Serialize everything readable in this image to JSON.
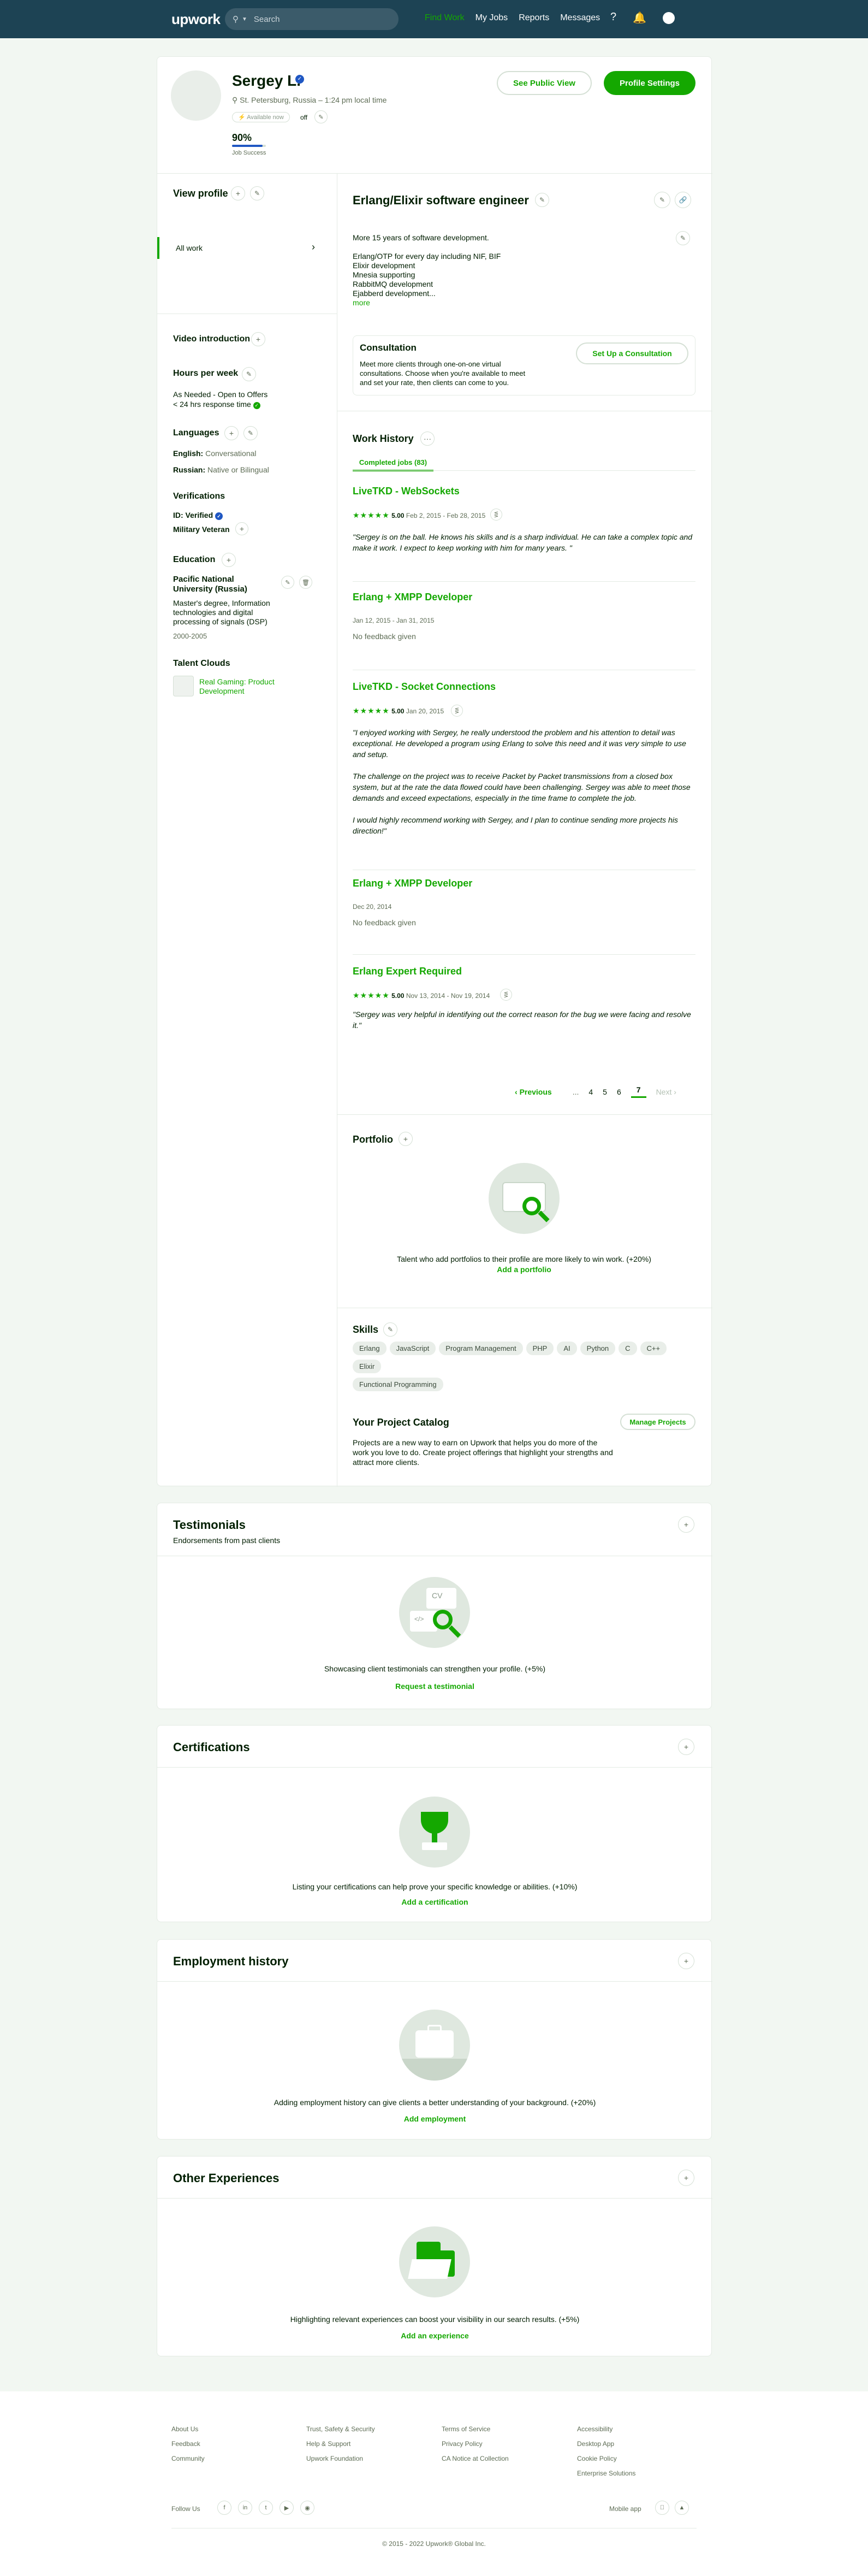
{
  "nav": {
    "logo": "upwork",
    "search_placeholder": "Search",
    "links": [
      "Find Work",
      "My Jobs",
      "Reports",
      "Messages"
    ]
  },
  "profile": {
    "name": "Sergey L.",
    "location": "St. Petersburg, Russia – 1:24 pm local time",
    "availability": "Available now",
    "availability_toggle": "off",
    "job_success": "90%",
    "job_success_label": "Job Success",
    "public_view": "See Public View",
    "settings": "Profile Settings"
  },
  "sidebar": {
    "view_profile": "View profile",
    "all_work": "All work",
    "video_intro": "Video introduction",
    "hours_title": "Hours per week",
    "hours_value": "As Needed - Open to Offers",
    "response_time": "< 24 hrs response time",
    "languages_title": "Languages",
    "languages": [
      {
        "name": "English:",
        "level": "Conversational"
      },
      {
        "name": "Russian:",
        "level": "Native or Bilingual"
      }
    ],
    "verifications_title": "Verifications",
    "id_verified": "ID: Verified",
    "military": "Military Veteran",
    "education_title": "Education",
    "school": "Pacific National University (Russia)",
    "degree": "Master's degree, Information technologies and digital processing of signals (DSP)",
    "years": "2000-2005",
    "clouds_title": "Talent Clouds",
    "cloud_name": "Real Gaming: Product Development"
  },
  "main": {
    "title": "Erlang/Elixir software engineer",
    "overview": [
      "More 15 years of software development.",
      "",
      "Erlang/OTP for every day including NIF, BIF",
      "Elixir development",
      "Mnesia supporting",
      "RabbitMQ development",
      "Ejabberd development..."
    ],
    "more": "more",
    "consult_title": "Consultation",
    "consult_text": "Meet more clients through one-on-one virtual consultations. Choose when you're available to meet and set your rate, then clients can come to you.",
    "consult_btn": "Set Up a Consultation",
    "work_history": "Work History",
    "tab_completed": "Completed jobs (83)"
  },
  "jobs": [
    {
      "title": "LiveTKD - WebSockets",
      "rating": "5.00",
      "dates": "Feb 2, 2015 - Feb 28, 2015",
      "feedback": "\"Sergey is on the ball. He knows his skills and is a sharp individual. He can take a complex topic and make it work. I expect to keep working with him for many years. \""
    },
    {
      "title": "Erlang + XMPP Developer",
      "dates": "Jan 12, 2015 - Jan 31, 2015",
      "nofeedback": "No feedback given"
    },
    {
      "title": "LiveTKD - Socket Connections",
      "rating": "5.00",
      "dates": "Jan 20, 2015",
      "feedback": "\"I enjoyed working with Sergey, he really understood the problem and his attention to detail was exceptional. He developed a program using Erlang to solve this need and it was very simple to use and setup.",
      "feedback2": "The challenge on the project was to receive Packet by Packet transmissions from a closed box system, but at the rate the data flowed could have been challenging. Sergey was able to meet those demands and exceed expectations, especially in the time frame to complete the job.",
      "feedback3": "I would highly recommend working with Sergey, and I plan to continue sending more projects his direction!\""
    },
    {
      "title": "Erlang + XMPP Developer",
      "dates": "Dec 20, 2014",
      "nofeedback": "No feedback given"
    },
    {
      "title": "Erlang Expert Required",
      "rating": "5.00",
      "dates": "Nov 13, 2014 - Nov 19, 2014",
      "feedback": "\"Sergey was very helpful in identifying out the correct reason for the bug we were facing and resolve it.\""
    }
  ],
  "pagination": {
    "prev": "Previous",
    "ellipsis": "...",
    "pages": [
      "4",
      "5",
      "6",
      "7"
    ],
    "current": "7",
    "next": "Next"
  },
  "portfolio": {
    "title": "Portfolio",
    "text": "Talent who add portfolios to their profile are more likely to win work. (+20%)",
    "link": "Add a portfolio"
  },
  "skills": {
    "title": "Skills",
    "items": [
      "Erlang",
      "JavaScript",
      "Program Management",
      "PHP",
      "AI",
      "Python",
      "C",
      "C++",
      "Elixir",
      "Functional Programming"
    ]
  },
  "catalog": {
    "title": "Your Project Catalog",
    "text": "Projects are a new way to earn on Upwork that helps you do more of the work you love to do. Create project offerings that highlight your strengths and attract more clients.",
    "btn": "Manage Projects"
  },
  "testimonials": {
    "title": "Testimonials",
    "sub": "Endorsements from past clients",
    "text": "Showcasing client testimonials can strengthen your profile. (+5%)",
    "link": "Request a testimonial",
    "cv": "CV"
  },
  "certifications": {
    "title": "Certifications",
    "text": "Listing your certifications can help prove your specific knowledge or abilities. (+10%)",
    "link": "Add a certification"
  },
  "employment": {
    "title": "Employment history",
    "text": "Adding employment history can give clients a better understanding of your background. (+20%)",
    "link": "Add employment"
  },
  "other": {
    "title": "Other Experiences",
    "text": "Highlighting relevant experiences can boost your visibility in our search results. (+5%)",
    "link": "Add an experience"
  },
  "footer": {
    "cols": [
      [
        "About Us",
        "Feedback",
        "Community"
      ],
      [
        "Trust, Safety & Security",
        "Help & Support",
        "Upwork Foundation"
      ],
      [
        "Terms of Service",
        "Privacy Policy",
        "CA Notice at Collection"
      ],
      [
        "Accessibility",
        "Desktop App",
        "Cookie Policy",
        "Enterprise Solutions"
      ]
    ],
    "follow": "Follow Us",
    "mobile": "Mobile app",
    "copyright": "© 2015 - 2022 Upwork® Global Inc."
  }
}
